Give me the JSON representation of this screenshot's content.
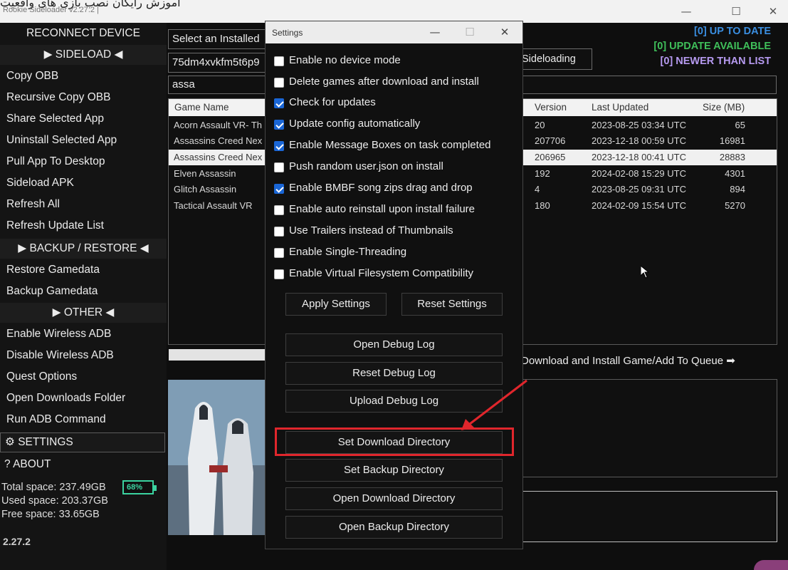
{
  "window": {
    "overlay_text": "آموزش رایگان نصب بازی های واقعیت",
    "app_title": "Rookie Sideloader v2.27.2 |",
    "minimize_glyph": "—",
    "maximize_glyph": "☐",
    "close_glyph": "✕"
  },
  "sidebar": {
    "reconnect": "RECONNECT DEVICE",
    "sideload_header": "▶ SIDELOAD ◀",
    "sideload_items": [
      "Copy OBB",
      "Recursive Copy OBB",
      "Share Selected App",
      "Uninstall Selected App",
      "Pull App To Desktop",
      "Sideload APK",
      "Refresh All",
      "Refresh Update List"
    ],
    "backup_header": "▶ BACKUP / RESTORE ◀",
    "backup_items": [
      "Restore Gamedata",
      "Backup Gamedata"
    ],
    "other_header": "▶ OTHER ◀",
    "other_items": [
      "Enable  Wireless ADB",
      "Disable Wireless ADB",
      "Quest Options",
      "Open Downloads Folder",
      "Run ADB Command"
    ],
    "settings": "⚙ SETTINGS",
    "about": "?  ABOUT",
    "total_space": "Total space: 237.49GB",
    "used_space": "Used space: 203.37GB",
    "free_space": "Free space: 33.65GB",
    "battery_pct": "68%",
    "battery_level": 0.68,
    "version": "2.27.2"
  },
  "main": {
    "installed_select": "Select an Installed",
    "device_id": "75dm4xvkfm5t6p9",
    "sideloading_label": "Sideloading",
    "search_value": "assa",
    "status_up_to_date": "[0] UP TO DATE",
    "status_update_available": "[0] UPDATE AVAILABLE",
    "status_newer": "[0] NEWER THAN LIST",
    "table": {
      "headers": [
        "Game Name",
        "Version",
        "Last Updated",
        "Size (MB)"
      ],
      "rows": [
        {
          "name": "Acorn Assault VR- Th",
          "version": "20",
          "updated": "2023-08-25 03:34 UTC",
          "size": "65"
        },
        {
          "name": "Assassins Creed Nex",
          "version": "207706",
          "updated": "2023-12-18 00:59 UTC",
          "size": "16981"
        },
        {
          "name": "Assassins Creed Nex",
          "version": "206965",
          "updated": "2023-12-18 00:41 UTC",
          "size": "28883"
        },
        {
          "name": "Elven Assassin",
          "version": "192",
          "updated": "2024-02-08 15:29 UTC",
          "size": "4301"
        },
        {
          "name": "Glitch Assassin",
          "version": "4",
          "updated": "2023-08-25 09:31 UTC",
          "size": "894"
        },
        {
          "name": "Tactical Assault VR",
          "version": "180",
          "updated": "2024-02-09 15:54 UTC",
          "size": "5270"
        }
      ]
    },
    "download_label": "Download and Install Game/Add To Queue ➡"
  },
  "dialog": {
    "title": "Settings",
    "minimize_glyph": "—",
    "maximize_glyph": "☐",
    "close_glyph": "✕",
    "options": [
      {
        "label": "Enable no device mode",
        "checked": false
      },
      {
        "label": "Delete games after download and install",
        "checked": false
      },
      {
        "label": "Check for updates",
        "checked": true
      },
      {
        "label": "Update config automatically",
        "checked": true
      },
      {
        "label": "Enable Message Boxes on task completed",
        "checked": true
      },
      {
        "label": "Push random user.json on install",
        "checked": false
      },
      {
        "label": "Enable BMBF song zips drag and drop",
        "checked": true
      },
      {
        "label": "Enable auto reinstall upon install failure",
        "checked": false
      },
      {
        "label": "Use Trailers instead of Thumbnails",
        "checked": false
      },
      {
        "label": "Enable Single-Threading",
        "checked": false
      },
      {
        "label": "Enable Virtual Filesystem Compatibility",
        "checked": false
      }
    ],
    "apply_settings": "Apply Settings",
    "reset_settings": "Reset Settings",
    "open_debug_log": "Open Debug Log",
    "reset_debug_log": "Reset Debug Log",
    "upload_debug_log": "Upload Debug Log",
    "set_download_directory": "Set Download Directory",
    "set_backup_directory": "Set Backup Directory",
    "open_download_directory": "Open Download Directory",
    "open_backup_directory": "Open Backup Directory"
  },
  "annotation": {
    "highlight_color": "#e0262c"
  }
}
